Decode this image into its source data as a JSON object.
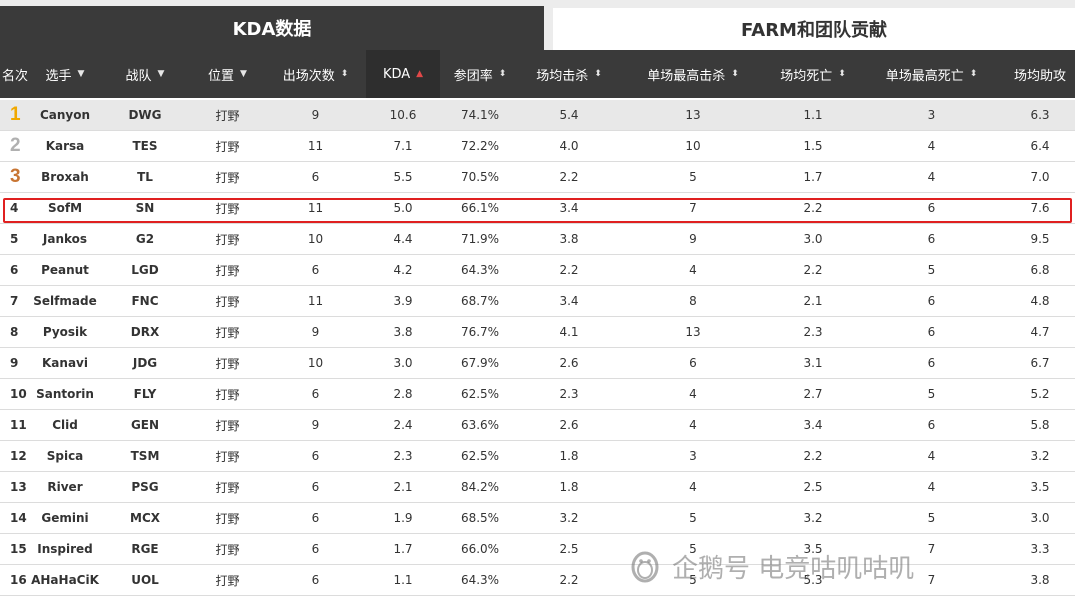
{
  "tabs": {
    "active": "KDA数据",
    "inactive": "FARM和团队贡献"
  },
  "columns": [
    {
      "label": "名次",
      "icon": ""
    },
    {
      "label": "选手",
      "icon": "filter-icon"
    },
    {
      "label": "战队",
      "icon": "filter-icon"
    },
    {
      "label": "位置",
      "icon": "filter-icon"
    },
    {
      "label": "出场次数",
      "icon": "sort-icon"
    },
    {
      "label": "KDA",
      "icon": "sort-desc-icon"
    },
    {
      "label": "参团率",
      "icon": "sort-icon"
    },
    {
      "label": "场均击杀",
      "icon": "sort-icon"
    },
    {
      "label": "单场最高击杀",
      "icon": "sort-icon"
    },
    {
      "label": "场均死亡",
      "icon": "sort-icon"
    },
    {
      "label": "单场最高死亡",
      "icon": "sort-icon"
    },
    {
      "label": "场均助攻",
      "icon": ""
    }
  ],
  "colors": {
    "header_bg": "#3a3a3a",
    "gold": "#f0a800",
    "silver": "#b0b0b0",
    "bronze": "#c87533",
    "highlight": "#e02020"
  },
  "rows": [
    [
      "1",
      "Canyon",
      "DWG",
      "打野",
      "9",
      "10.6",
      "74.1%",
      "5.4",
      "13",
      "1.1",
      "3",
      "6.3"
    ],
    [
      "2",
      "Karsa",
      "TES",
      "打野",
      "11",
      "7.1",
      "72.2%",
      "4.0",
      "10",
      "1.5",
      "4",
      "6.4"
    ],
    [
      "3",
      "Broxah",
      "TL",
      "打野",
      "6",
      "5.5",
      "70.5%",
      "2.2",
      "5",
      "1.7",
      "4",
      "7.0"
    ],
    [
      "4",
      "SofM",
      "SN",
      "打野",
      "11",
      "5.0",
      "66.1%",
      "3.4",
      "7",
      "2.2",
      "6",
      "7.6"
    ],
    [
      "5",
      "Jankos",
      "G2",
      "打野",
      "10",
      "4.4",
      "71.9%",
      "3.8",
      "9",
      "3.0",
      "6",
      "9.5"
    ],
    [
      "6",
      "Peanut",
      "LGD",
      "打野",
      "6",
      "4.2",
      "64.3%",
      "2.2",
      "4",
      "2.2",
      "5",
      "6.8"
    ],
    [
      "7",
      "Selfmade",
      "FNC",
      "打野",
      "11",
      "3.9",
      "68.7%",
      "3.4",
      "8",
      "2.1",
      "6",
      "4.8"
    ],
    [
      "8",
      "Pyosik",
      "DRX",
      "打野",
      "9",
      "3.8",
      "76.7%",
      "4.1",
      "13",
      "2.3",
      "6",
      "4.7"
    ],
    [
      "9",
      "Kanavi",
      "JDG",
      "打野",
      "10",
      "3.0",
      "67.9%",
      "2.6",
      "6",
      "3.1",
      "6",
      "6.7"
    ],
    [
      "10",
      "Santorin",
      "FLY",
      "打野",
      "6",
      "2.8",
      "62.5%",
      "2.3",
      "4",
      "2.7",
      "5",
      "5.2"
    ],
    [
      "11",
      "Clid",
      "GEN",
      "打野",
      "9",
      "2.4",
      "63.6%",
      "2.6",
      "4",
      "3.4",
      "6",
      "5.8"
    ],
    [
      "12",
      "Spica",
      "TSM",
      "打野",
      "6",
      "2.3",
      "62.5%",
      "1.8",
      "3",
      "2.2",
      "4",
      "3.2"
    ],
    [
      "13",
      "River",
      "PSG",
      "打野",
      "6",
      "2.1",
      "84.2%",
      "1.8",
      "4",
      "2.5",
      "4",
      "3.5"
    ],
    [
      "14",
      "Gemini",
      "MCX",
      "打野",
      "6",
      "1.9",
      "68.5%",
      "3.2",
      "5",
      "3.2",
      "5",
      "3.0"
    ],
    [
      "15",
      "Inspired",
      "RGE",
      "打野",
      "6",
      "1.7",
      "66.0%",
      "2.5",
      "5",
      "3.5",
      "7",
      "3.3"
    ],
    [
      "16",
      "AHaHaCiK",
      "UOL",
      "打野",
      "6",
      "1.1",
      "64.3%",
      "2.2",
      "5",
      "5.3",
      "7",
      "3.8"
    ]
  ],
  "highlighted_player": "SofM",
  "watermark": "企鹅号 电竞咕叽咕叽"
}
